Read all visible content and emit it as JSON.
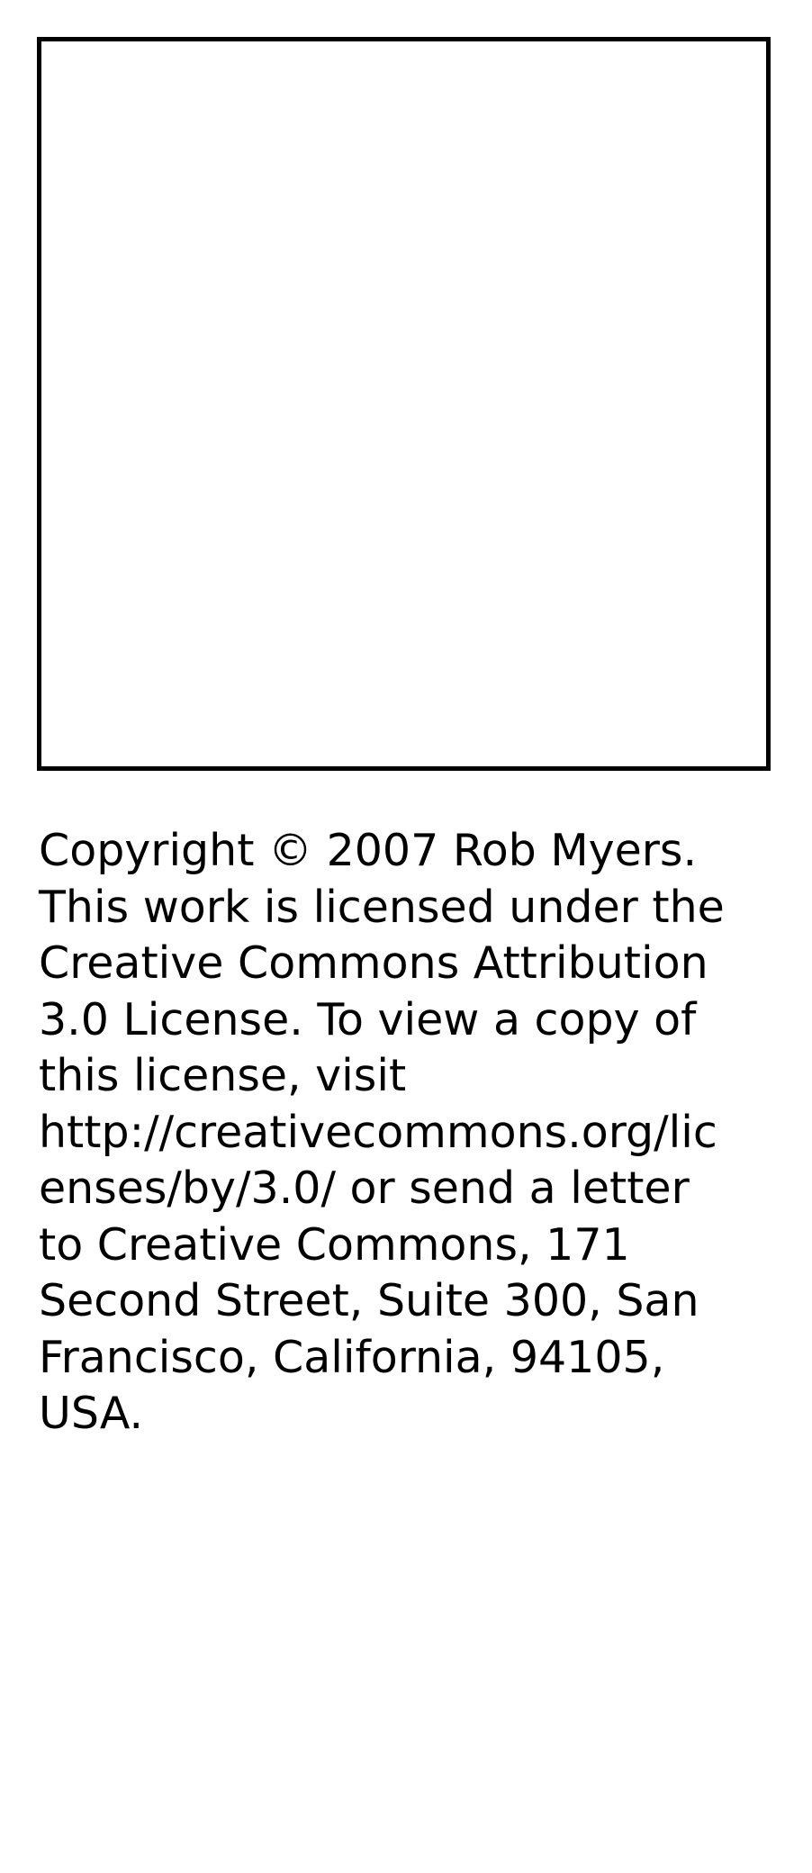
{
  "license": {
    "text": "Copyright © 2007 Rob Myers.\nThis work is licensed under the\nCreative Commons Attribution\n3.0 License. To view a copy of\nthis license, visit\nhttp://creativecommons.org/lic\nenses/by/3.0/ or send a letter\nto Creative Commons, 171\nSecond Street, Suite 300, San\nFrancisco, California, 94105,\nUSA."
  },
  "colors": {
    "background": "#ffffff",
    "text": "#000000",
    "frame_border": "#000000"
  }
}
